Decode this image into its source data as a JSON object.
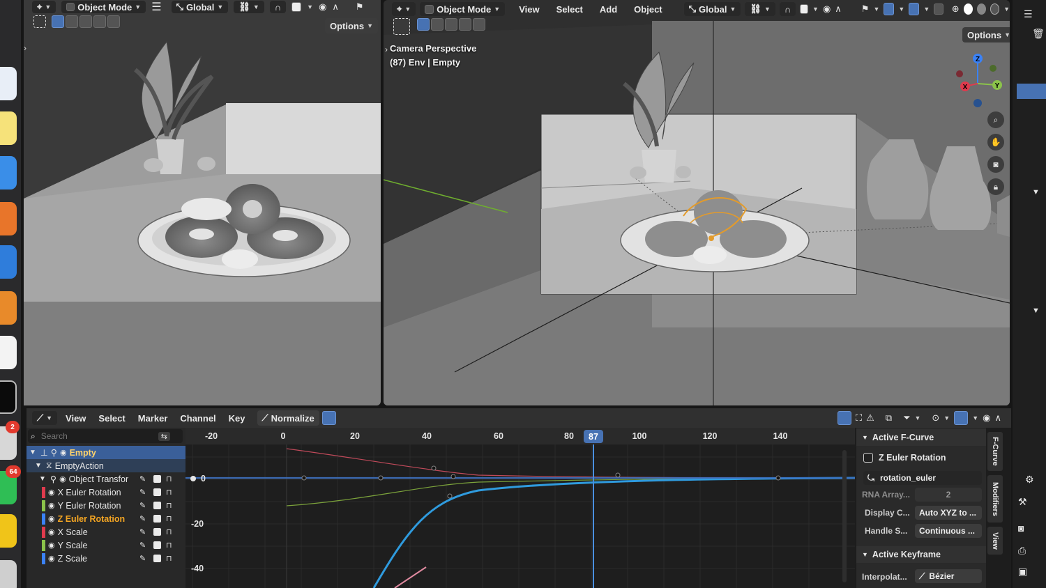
{
  "dock": {
    "badges": [
      "2",
      "64"
    ]
  },
  "left_viewport": {
    "mode_label": "Object Mode",
    "transform_orientation": "Global",
    "options_label": "Options"
  },
  "right_viewport": {
    "mode_label": "Object Mode",
    "menus": [
      "View",
      "Select",
      "Add",
      "Object"
    ],
    "transform_orientation": "Global",
    "options_label": "Options",
    "overlay_title": "Camera Perspective",
    "overlay_subtitle": "(87) Env | Empty",
    "gizmo_axes": [
      "Z",
      "Y",
      "X"
    ]
  },
  "graph_editor": {
    "menus": [
      "View",
      "Select",
      "Marker",
      "Channel",
      "Key"
    ],
    "normalize_label": "Normalize",
    "search_placeholder": "Search",
    "ruler_labels": [
      "-20",
      "0",
      "20",
      "40",
      "60",
      "80",
      "100",
      "120",
      "140"
    ],
    "current_frame": "87",
    "value_labels": [
      "0",
      "-20",
      "-40"
    ],
    "channels": [
      {
        "label": "Empty",
        "level": 0,
        "highlight": true
      },
      {
        "label": "EmptyAction",
        "level": 1
      },
      {
        "label": "Object Transfor",
        "level": 2
      },
      {
        "label": "X Euler Rotation",
        "level": 3,
        "color": "#e03a4d"
      },
      {
        "label": "Y Euler Rotation",
        "level": 3,
        "color": "#8bc34a"
      },
      {
        "label": "Z Euler Rotation",
        "level": 3,
        "color": "#3b82f6",
        "active": true
      },
      {
        "label": "X Scale",
        "level": 3,
        "color": "#e03a4d"
      },
      {
        "label": "Y Scale",
        "level": 3,
        "color": "#8bc34a"
      },
      {
        "label": "Z Scale",
        "level": 3,
        "color": "#3b82f6"
      }
    ],
    "sidebar": {
      "active_fcurve_header": "Active F-Curve",
      "fcurve_name": "Z Euler Rotation",
      "rna_path": "rotation_euler",
      "rna_array_label": "RNA Array...",
      "rna_array_value": "2",
      "display_color_label": "Display C...",
      "display_color_value": "Auto XYZ to ...",
      "handle_smoothing_label": "Handle S...",
      "handle_smoothing_value": "Continuous ...",
      "active_keyframe_header": "Active Keyframe",
      "interpolation_label": "Interpolat...",
      "interpolation_value": "Bézier"
    },
    "tabs": [
      "F-Curve",
      "Modifiers",
      "View"
    ]
  },
  "colors": {
    "accent_blue": "#4772b3",
    "active_curve": "#2f9bde",
    "header": "#303030"
  }
}
